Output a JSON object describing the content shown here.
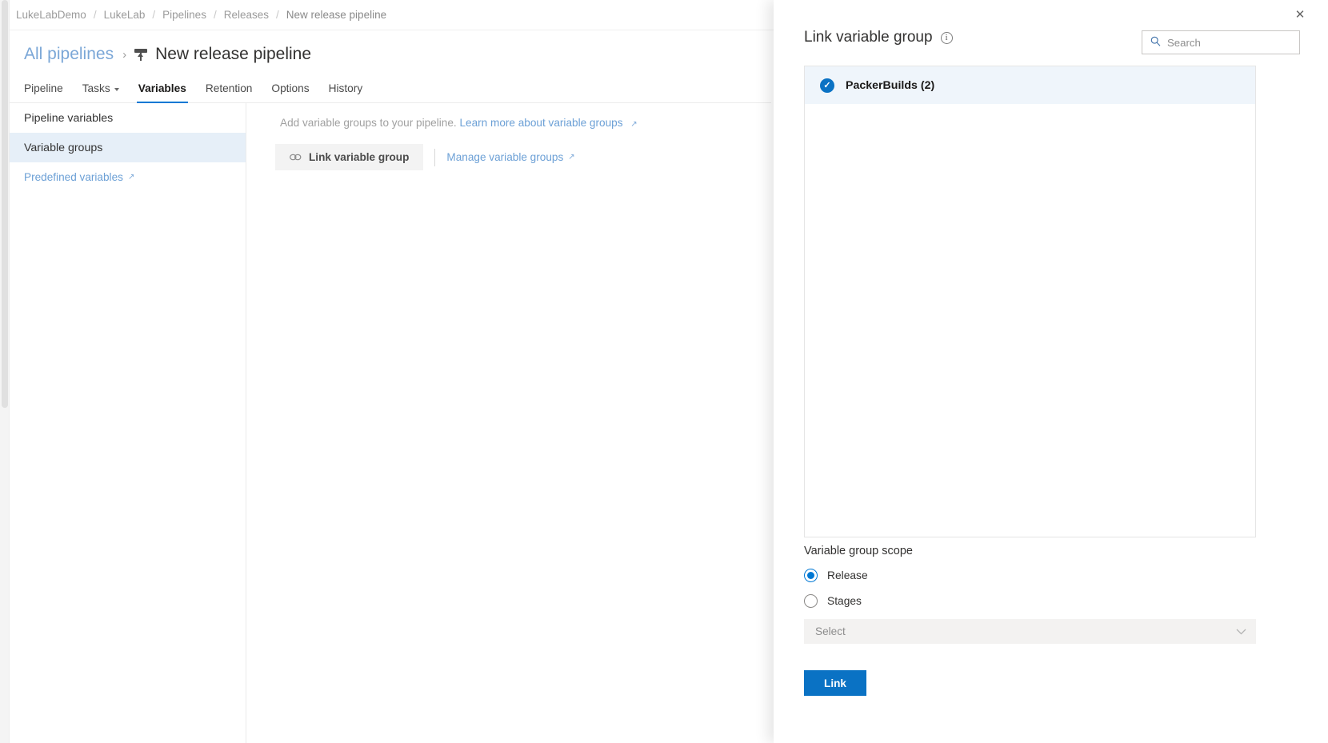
{
  "breadcrumb": {
    "items": [
      "LukeLabDemo",
      "LukeLab",
      "Pipelines",
      "Releases",
      "New release pipeline"
    ],
    "separator": "/"
  },
  "header": {
    "parent_link": "All pipelines",
    "chevron": "›",
    "title": "New release pipeline",
    "pipeline_icon": "release-pipeline-icon"
  },
  "tabs": [
    {
      "label": "Pipeline",
      "active": false,
      "has_caret": false
    },
    {
      "label": "Tasks",
      "active": false,
      "has_caret": true
    },
    {
      "label": "Variables",
      "active": true,
      "has_caret": false
    },
    {
      "label": "Retention",
      "active": false,
      "has_caret": false
    },
    {
      "label": "Options",
      "active": false,
      "has_caret": false
    },
    {
      "label": "History",
      "active": false,
      "has_caret": false
    }
  ],
  "leftnav": {
    "items": [
      {
        "label": "Pipeline variables",
        "selected": false,
        "external": false
      },
      {
        "label": "Variable groups",
        "selected": true,
        "external": false
      },
      {
        "label": "Predefined variables",
        "selected": false,
        "external": true
      }
    ],
    "external_glyph": "↗"
  },
  "main": {
    "hint_text": "Add variable groups to your pipeline.",
    "hint_link": "Learn more about variable groups",
    "hint_link_glyph": "↗",
    "link_button_label": "Link variable group",
    "link_button_icon": "chain-link-icon",
    "link_button_glyph": "∞",
    "manage_link": "Manage variable groups",
    "manage_link_glyph": "↗"
  },
  "panel": {
    "title": "Link variable group",
    "info_icon": "info-icon",
    "info_glyph": "i",
    "close_icon": "close-icon",
    "close_glyph": "✕",
    "search": {
      "placeholder": "Search",
      "value": "",
      "icon": "search-icon",
      "icon_glyph": "⚲"
    },
    "variable_groups": [
      {
        "name": "PackerBuilds (2)",
        "selected": true,
        "check_glyph": "✓"
      }
    ],
    "scope": {
      "label": "Variable group scope",
      "options": [
        {
          "label": "Release",
          "selected": true
        },
        {
          "label": "Stages",
          "selected": false
        }
      ],
      "stages_select": {
        "placeholder": "Select",
        "value": "",
        "chevron_icon": "chevron-down-icon",
        "chevron_glyph": "⌄"
      }
    },
    "primary_button": "Link",
    "accent_color": "#0a72c4",
    "selected_row_color": "#eff5fb"
  }
}
